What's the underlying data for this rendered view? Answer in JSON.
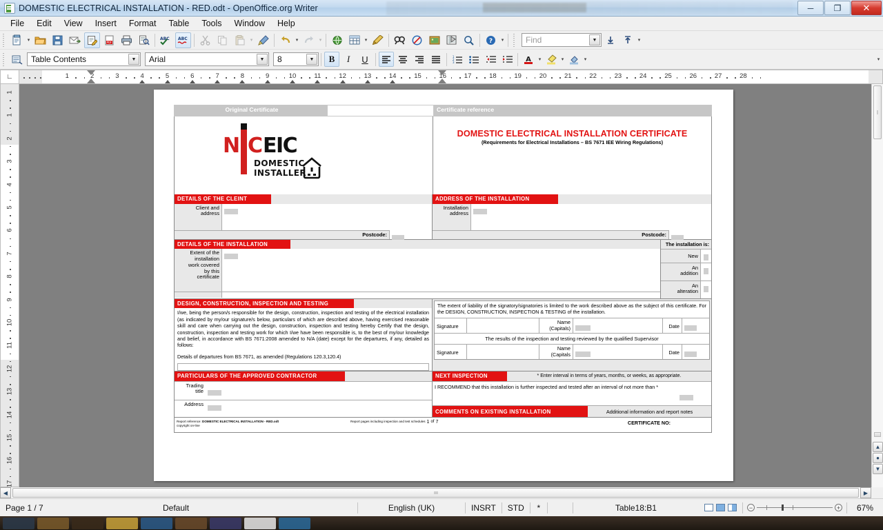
{
  "window": {
    "title": "DOMESTIC ELECTRICAL INSTALLATION - RED.odt - OpenOffice.org Writer",
    "app_icon": "writer-document-icon",
    "minimize": "─",
    "maximize": "❐",
    "close": "✕"
  },
  "menus": [
    {
      "label": "File",
      "key": "F"
    },
    {
      "label": "Edit",
      "key": "E"
    },
    {
      "label": "View",
      "key": "V"
    },
    {
      "label": "Insert",
      "key": "I"
    },
    {
      "label": "Format",
      "key": "o"
    },
    {
      "label": "Table",
      "key": "a"
    },
    {
      "label": "Tools",
      "key": "T"
    },
    {
      "label": "Window",
      "key": "W"
    },
    {
      "label": "Help",
      "key": "H"
    }
  ],
  "standard_toolbar": {
    "items": [
      {
        "name": "new-document-button",
        "glyph": "὜B",
        "state": "normal"
      },
      {
        "name": "new-document-dropdown",
        "glyph": "▾",
        "state": "caret"
      },
      {
        "name": "open-document-button",
        "glyph": "Ὄ2",
        "state": "normal"
      },
      {
        "name": "save-button",
        "glyph": "ὋE",
        "state": "normal"
      },
      {
        "name": "email-document-button",
        "glyph": "✉",
        "state": "normal"
      },
      {
        "name": "edit-file-button",
        "glyph": "✎",
        "state": "active"
      },
      {
        "name": "export-pdf-button",
        "glyph": "Ὄ4",
        "state": "normal"
      },
      {
        "name": "print-button",
        "glyph": "Ὓ6",
        "state": "normal"
      },
      {
        "name": "print-preview-button",
        "glyph": "ὐD",
        "state": "normal"
      },
      {
        "name": "spelling-button",
        "glyph": "ABC",
        "state": "normal"
      },
      {
        "name": "autospellcheck-button",
        "glyph": "ABC",
        "state": "active"
      },
      {
        "name": "cut-button",
        "glyph": "✂",
        "state": "disabled"
      },
      {
        "name": "copy-button",
        "glyph": "❐",
        "state": "disabled"
      },
      {
        "name": "paste-button",
        "glyph": "ὌB",
        "state": "disabled"
      },
      {
        "name": "paste-dropdown",
        "glyph": "▾",
        "state": "caret-disabled"
      },
      {
        "name": "clone-formatting-button",
        "glyph": "὘C",
        "state": "normal"
      },
      {
        "name": "undo-button",
        "glyph": "↶",
        "state": "normal"
      },
      {
        "name": "undo-dropdown",
        "glyph": "▾",
        "state": "caret"
      },
      {
        "name": "redo-button",
        "glyph": "↷",
        "state": "disabled"
      },
      {
        "name": "redo-dropdown",
        "glyph": "▾",
        "state": "caret-disabled"
      },
      {
        "name": "hyperlink-button",
        "glyph": "ἱ0",
        "state": "normal"
      },
      {
        "name": "insert-table-button",
        "glyph": "▦",
        "state": "normal"
      },
      {
        "name": "insert-table-dropdown",
        "glyph": "▾",
        "state": "caret"
      },
      {
        "name": "show-draw-functions-button",
        "glyph": "✏",
        "state": "normal"
      },
      {
        "name": "find-replace-button",
        "glyph": "ὐE",
        "state": "normal"
      },
      {
        "name": "nonprinting-chars-button",
        "glyph": "¶",
        "state": "normal"
      },
      {
        "name": "gallery-button",
        "glyph": "ὛC",
        "state": "normal"
      },
      {
        "name": "data-sources-button",
        "glyph": "὜3",
        "state": "normal"
      },
      {
        "name": "zoom-button",
        "glyph": "ὐD",
        "state": "normal"
      },
      {
        "name": "help-button",
        "glyph": "?",
        "state": "normal"
      }
    ],
    "find_placeholder": "Find",
    "find_value": "",
    "find_prev": "⇧",
    "find_next": "⇩"
  },
  "formatting_toolbar": {
    "apply_style_icon": "apply-style-icon",
    "paragraph_style": "Table Contents",
    "font_name": "Arial",
    "font_size": "8",
    "bold": "B",
    "italic": "I",
    "underline": "U",
    "align_left": "≡",
    "align_center": "≡",
    "align_right": "≡",
    "justify": "≡",
    "numbered_list": "≣",
    "bullet_list": "≣",
    "decrease_indent": "⇤",
    "increase_indent": "⇥",
    "font_color": "A",
    "highlight": "὘D",
    "background_color": "▣",
    "active_alignment": "align_left"
  },
  "rulers": {
    "horizontal_unit_marks": [
      1,
      2,
      3,
      4,
      5,
      6,
      7,
      8,
      9,
      10,
      11,
      12,
      13,
      14,
      15,
      16,
      17,
      18,
      19,
      20,
      21,
      22,
      23,
      24,
      25,
      26,
      27,
      28
    ],
    "vertical_unit_marks": [
      1,
      1,
      2,
      3,
      4,
      5,
      6,
      7,
      8,
      9,
      10,
      11,
      12,
      13,
      14,
      15,
      16,
      17
    ]
  },
  "statusbar": {
    "page": "Page 1 / 7",
    "page_style": "Default",
    "language": "English (UK)",
    "insert_mode": "INSRT",
    "selection_mode": "STD",
    "modified": "*",
    "object_info": "Table18:B1",
    "zoom_level": "67%",
    "view_single": "single-page-view-icon",
    "view_multi": "multi-page-view-icon",
    "view_book": "book-view-icon",
    "zoom_out": "−",
    "zoom_in": "+"
  },
  "certificate": {
    "header": {
      "original_certificate_label": "Original Certificate",
      "original_certificate_value": "",
      "certificate_reference_label": "Certificate reference",
      "title": "DOMESTIC ELECTRICAL INSTALLATION CERTIFICATE",
      "subtitle": "(Requirements for Electrical Installations – BS 7671 IEE Wiring Regulations)"
    },
    "logo": {
      "n": "N",
      "c": "C",
      "eic": "EIC",
      "line1": "DOMESTIC",
      "line2": "INSTALLER",
      "house_icon": "house-with-socket-icon"
    },
    "client": {
      "heading": "DETAILS OF THE CLEINT",
      "field_label": "Client and\naddress",
      "field_value": "",
      "postcode_label": "Postcode:",
      "postcode_value": ""
    },
    "installation_address": {
      "heading": "ADDRESS OF THE INSTALLATION",
      "field_label": "Installation\naddress",
      "field_value": "",
      "postcode_label": "Postcode:",
      "postcode_value": ""
    },
    "installation_details": {
      "heading": "DETAILS OF THE INSTALLATION",
      "field_label": "Extent of the\ninstallation\nwork covered\nby this\ncertificate",
      "field_value": "",
      "type_heading": "The installation is:",
      "options": [
        {
          "label": "New",
          "checked": false
        },
        {
          "label": "An\naddition",
          "checked": false
        },
        {
          "label": "An\nalteration",
          "checked": false
        }
      ]
    },
    "design": {
      "heading": "DESIGN, CONSTRUCTION, INSPECTION AND TESTING",
      "declaration": "I/we,  being  the  person/s   responsible  for  the  design,  construction,  inspection  and  testing  of  the  electrical  installation  (as  indicated  by  my/our  signature/s  below,  particulars  of  which  are  described above,  having  exercised  reasonable  skill  and  care  when  carrying  out  the  design,  construction, inspection and testing hereby Certify that the design, construction, inspection and testing work for which I/we have been  responsible is, to the best of my/our knowledge and belief, in accordance with BS 7671:2008 amended to N/A  (date)  except for the departures, if any, detailed as follows:",
      "departures_label": "Details of departures from BS 7671, as amended (Regulations 120.3,120.4)",
      "departures_value": ""
    },
    "liability": {
      "text": "The  extent  of  liability  of  the  signatory/signatories  is  limited  to  the  work  described  above  as  the subject  of  this  certificate.  For  the  DESIGN,  CONSTRUCTION,  INSPECTION  &  TESTING  of  the installation.",
      "signature_label": "Signature",
      "signature_value": "",
      "name_label": "Name\n(Capitals)",
      "name_value": "",
      "date_label": "Date",
      "date_value": "",
      "supervisor_text": "The results of the inspection and testing reviewed by the qualified Supervisor",
      "supervisor_signature_label": "Signature",
      "supervisor_signature_value": "",
      "supervisor_name_label": "Name\n(Capitals",
      "supervisor_name_value": "",
      "supervisor_date_label": "Date",
      "supervisor_date_value": ""
    },
    "contractor": {
      "heading": "PARTICULARS OF THE APPROVED CONTRACTOR",
      "trading_title_label": "Trading\ntitle",
      "trading_title_value": "",
      "address_label": "Address",
      "address_value": ""
    },
    "next_inspection": {
      "heading": "NEXT INSPECTION",
      "note": "* Enter interval in terms of years, months, or weeks, as appropriate.",
      "recommendation": "I RECOMMEND that this installation is further inspected and tested after an interval of not more than *",
      "interval_value": ""
    },
    "comments": {
      "heading": "COMMENTS ON EXISTING INSTALLATION",
      "note": "Additional information and report notes"
    },
    "footer": {
      "report_ref_label": "Report reference:",
      "report_ref_value": "DOMESTIC ELECTRICAL INSTALLATION - RED.odt",
      "copyright": "copyright on-line",
      "pages_label": "Report pages including inspection and test schedules",
      "pages_current": "1",
      "pages_of": "of",
      "pages_total": "7",
      "certificate_no_label": "CERTIFICATE NO:"
    }
  }
}
